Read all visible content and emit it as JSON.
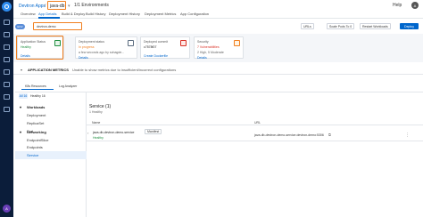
{
  "header": {
    "app_crumb": "Devtron Apps",
    "app_name": "java-db",
    "env_label": "1/1 Environments",
    "help": "Help",
    "user_initial": "A"
  },
  "tabs": [
    "Overview",
    "App Details",
    "Build & Deploy",
    "Build History",
    "Deployment History",
    "Deployment Metrics",
    "App Configuration"
  ],
  "toolbar": {
    "env_chip": "ENV",
    "env_value": "devtron-demo",
    "urls": "URLs",
    "scale": "Scale Pods To 0",
    "restart": "Restart Workloads",
    "deploy": "Deploy"
  },
  "cards": {
    "status": {
      "title": "Application Status",
      "value": "Healthy",
      "link": "Details"
    },
    "deploy": {
      "title": "Deployment status",
      "value": "In progress",
      "detail": "a few seconds ago by sohagde...",
      "link": "Details"
    },
    "commit": {
      "title": "Deployed commit",
      "value": "c7578f07",
      "link": "Create Dockerfile"
    },
    "security": {
      "title": "Security",
      "value": "7 Vulnerabilities",
      "detail": "2 High, 5 Moderate",
      "link": "Details"
    }
  },
  "metrics": {
    "title": "APPLICATION METRICS",
    "message": "Unable to show metrics due to insufficient/incorrect configurations"
  },
  "resource_tabs": {
    "k8s": "K8s Resources",
    "log": "Log Analyzer"
  },
  "filters": {
    "all": "All 16",
    "healthy": "Healthy 16"
  },
  "sidebar": {
    "workloads": "Workloads",
    "deployment": "Deployment",
    "replicaset": "ReplicaSet",
    "pod": "Pod",
    "networking": "Networking",
    "endpointslice": "EndpointSlice",
    "endpoints": "Endpoints",
    "service": "Service"
  },
  "service": {
    "title": "Service (1)",
    "subtitle": "1 Healthy",
    "col_name": "Name",
    "col_url": "URL",
    "row_name": "java-db-devtron-demo-service",
    "row_status": "Healthy",
    "manifest": "Manifest",
    "row_url": "java-db-devtron-demo-service.devtron-demo:5306"
  },
  "colors": {
    "accent": "#0066cc",
    "highlight": "#f07f1f",
    "rail": "#0b1d3a",
    "healthy": "#1e8e3e"
  }
}
